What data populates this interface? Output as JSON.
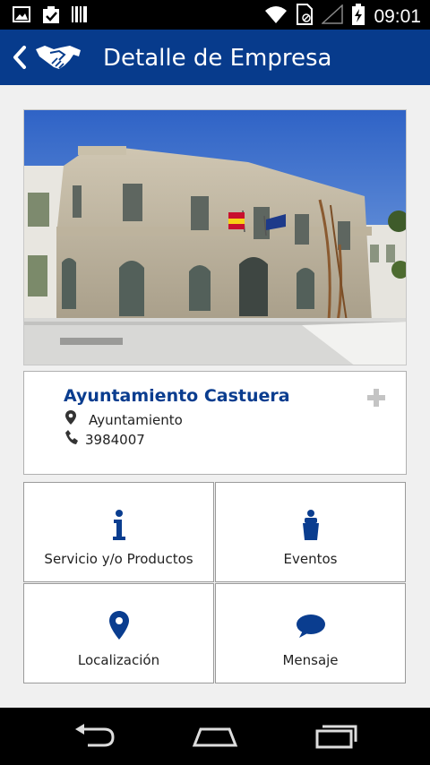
{
  "status_bar": {
    "time": "09:01",
    "left_icons": [
      "image-icon",
      "clipboard-check-icon",
      "barcode-icon"
    ],
    "right_icons": [
      "wifi-icon",
      "sim-icon",
      "signal-icon",
      "battery-charging-icon"
    ]
  },
  "action_bar": {
    "title": "Detalle de Empresa",
    "back_icon": "chevron-left-icon",
    "logo_icon": "handshake-icon",
    "bg_color": "#073b8c"
  },
  "company": {
    "name": "Ayuntamiento Castuera",
    "address": "Ayuntamiento",
    "phone": "3984007",
    "add_icon": "plus-icon",
    "location_icon": "map-pin-icon",
    "phone_icon": "phone-icon",
    "accent_color": "#0a3d8f"
  },
  "tiles": [
    {
      "label": "Servicio y/o Productos",
      "icon": "info-icon"
    },
    {
      "label": "Eventos",
      "icon": "speaker-podium-icon"
    },
    {
      "label": "Localización",
      "icon": "map-pin-icon"
    },
    {
      "label": "Mensaje",
      "icon": "chat-bubble-icon"
    }
  ],
  "nav_bar": {
    "buttons": [
      "back-icon",
      "home-icon",
      "recent-apps-icon"
    ]
  }
}
